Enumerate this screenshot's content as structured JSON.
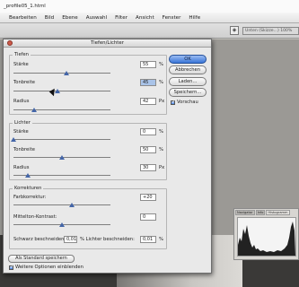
{
  "window": {
    "title": "_profile05_1.html"
  },
  "menubar": {
    "items": [
      "Bearbeiten",
      "Bild",
      "Ebene",
      "Auswahl",
      "Filter",
      "Ansicht",
      "Fenster",
      "Hilfe"
    ]
  },
  "options_bar": {
    "field_text": "Unten (Skizze...) 100%"
  },
  "histogram": {
    "tabs": [
      "Navigator",
      "Info",
      "Histogramm"
    ]
  },
  "dialog": {
    "title": "Tiefen/Lichter",
    "tiefen": {
      "label": "Tiefen",
      "staerke": {
        "label": "Stärke",
        "value": "55",
        "unit": "%",
        "level": 0.55
      },
      "tonbreite": {
        "label": "Tonbreite",
        "value": "45",
        "unit": "%",
        "level": 0.45
      },
      "radius": {
        "label": "Radius",
        "value": "42",
        "unit": "Px",
        "level": 0.21
      }
    },
    "lichter": {
      "label": "Lichter",
      "staerke": {
        "label": "Stärke",
        "value": "0",
        "unit": "%",
        "level": 0.0
      },
      "tonbreite": {
        "label": "Tonbreite",
        "value": "50",
        "unit": "%",
        "level": 0.5
      },
      "radius": {
        "label": "Radius",
        "value": "30",
        "unit": "Px",
        "level": 0.15
      }
    },
    "korrekturen": {
      "label": "Korrekturen",
      "farbkorrektur": {
        "label": "Farbkorrektur:",
        "value": "+20",
        "level": 0.6
      },
      "mitteltonkontrast": {
        "label": "Mittelton-Kontrast:",
        "value": "0",
        "level": 0.5
      },
      "schwarz": {
        "label": "Schwarz beschneiden:",
        "value": "0,01",
        "unit": "%"
      },
      "lichter_beschneiden": {
        "label": "% Lichter beschneiden:",
        "value": "0,01",
        "unit": "%"
      }
    },
    "buttons": {
      "ok": "OK",
      "abbrechen": "Abbrechen",
      "laden": "Laden...",
      "speichern": "Speichern..."
    },
    "vorschau": {
      "label": "Vorschau",
      "checked": true
    },
    "standard_button": "Als Standard speichern",
    "weitere": {
      "label": "Weitere Optionen einblenden",
      "checked": true
    }
  }
}
